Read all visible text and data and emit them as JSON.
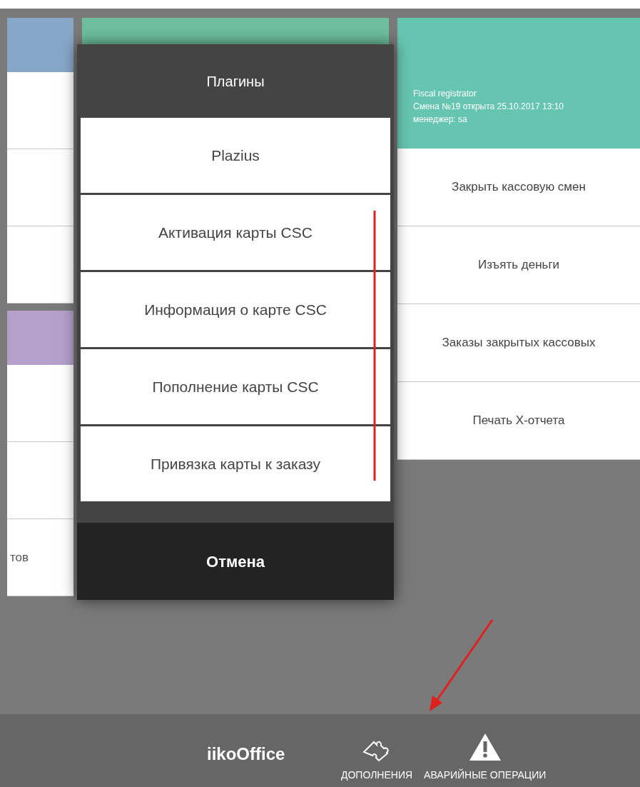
{
  "left_panel": {
    "rows": [
      {
        "kind": "header",
        "color": "#87a7c9"
      },
      {
        "kind": "row"
      },
      {
        "kind": "row"
      },
      {
        "kind": "row"
      },
      {
        "kind": "gap"
      },
      {
        "kind": "header",
        "color": "#b4a0cb"
      },
      {
        "kind": "row"
      },
      {
        "kind": "row"
      },
      {
        "kind": "row",
        "label": "тов"
      }
    ]
  },
  "service_panel": {
    "header_lines": [
      "Fiscal registrator",
      "Смена №19 открыта 25.10.2017 13:10",
      "менеджер: sa"
    ],
    "actions": [
      "Закрыть кассовую смен",
      "Изъять деньги",
      "Заказы закрытых кассовых",
      "Печать X-отчета"
    ]
  },
  "dialog": {
    "title": "Плагины",
    "items": [
      "Plazius",
      "Активация карты CSC",
      "Информация о карте CSC",
      "Пополнение карты CSC",
      "Привязка карты к заказу"
    ],
    "cancel": "Отмена"
  },
  "bottom_bar": {
    "brand": "iikoOffice",
    "buttons": [
      {
        "kind": "plugins",
        "label": "ДОПОЛНЕНИЯ"
      },
      {
        "kind": "warning",
        "label": "АВАРИЙНЫЕ ОПЕРАЦИИ"
      }
    ]
  }
}
